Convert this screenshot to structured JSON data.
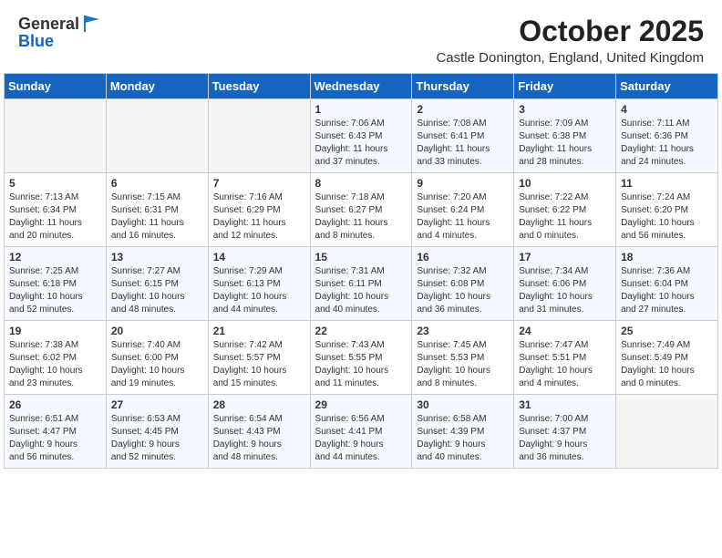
{
  "header": {
    "logo_line1": "General",
    "logo_line2": "Blue",
    "month": "October 2025",
    "location": "Castle Donington, England, United Kingdom"
  },
  "weekdays": [
    "Sunday",
    "Monday",
    "Tuesday",
    "Wednesday",
    "Thursday",
    "Friday",
    "Saturday"
  ],
  "weeks": [
    [
      {
        "day": "",
        "info": ""
      },
      {
        "day": "",
        "info": ""
      },
      {
        "day": "",
        "info": ""
      },
      {
        "day": "1",
        "info": "Sunrise: 7:06 AM\nSunset: 6:43 PM\nDaylight: 11 hours\nand 37 minutes."
      },
      {
        "day": "2",
        "info": "Sunrise: 7:08 AM\nSunset: 6:41 PM\nDaylight: 11 hours\nand 33 minutes."
      },
      {
        "day": "3",
        "info": "Sunrise: 7:09 AM\nSunset: 6:38 PM\nDaylight: 11 hours\nand 28 minutes."
      },
      {
        "day": "4",
        "info": "Sunrise: 7:11 AM\nSunset: 6:36 PM\nDaylight: 11 hours\nand 24 minutes."
      }
    ],
    [
      {
        "day": "5",
        "info": "Sunrise: 7:13 AM\nSunset: 6:34 PM\nDaylight: 11 hours\nand 20 minutes."
      },
      {
        "day": "6",
        "info": "Sunrise: 7:15 AM\nSunset: 6:31 PM\nDaylight: 11 hours\nand 16 minutes."
      },
      {
        "day": "7",
        "info": "Sunrise: 7:16 AM\nSunset: 6:29 PM\nDaylight: 11 hours\nand 12 minutes."
      },
      {
        "day": "8",
        "info": "Sunrise: 7:18 AM\nSunset: 6:27 PM\nDaylight: 11 hours\nand 8 minutes."
      },
      {
        "day": "9",
        "info": "Sunrise: 7:20 AM\nSunset: 6:24 PM\nDaylight: 11 hours\nand 4 minutes."
      },
      {
        "day": "10",
        "info": "Sunrise: 7:22 AM\nSunset: 6:22 PM\nDaylight: 11 hours\nand 0 minutes."
      },
      {
        "day": "11",
        "info": "Sunrise: 7:24 AM\nSunset: 6:20 PM\nDaylight: 10 hours\nand 56 minutes."
      }
    ],
    [
      {
        "day": "12",
        "info": "Sunrise: 7:25 AM\nSunset: 6:18 PM\nDaylight: 10 hours\nand 52 minutes."
      },
      {
        "day": "13",
        "info": "Sunrise: 7:27 AM\nSunset: 6:15 PM\nDaylight: 10 hours\nand 48 minutes."
      },
      {
        "day": "14",
        "info": "Sunrise: 7:29 AM\nSunset: 6:13 PM\nDaylight: 10 hours\nand 44 minutes."
      },
      {
        "day": "15",
        "info": "Sunrise: 7:31 AM\nSunset: 6:11 PM\nDaylight: 10 hours\nand 40 minutes."
      },
      {
        "day": "16",
        "info": "Sunrise: 7:32 AM\nSunset: 6:08 PM\nDaylight: 10 hours\nand 36 minutes."
      },
      {
        "day": "17",
        "info": "Sunrise: 7:34 AM\nSunset: 6:06 PM\nDaylight: 10 hours\nand 31 minutes."
      },
      {
        "day": "18",
        "info": "Sunrise: 7:36 AM\nSunset: 6:04 PM\nDaylight: 10 hours\nand 27 minutes."
      }
    ],
    [
      {
        "day": "19",
        "info": "Sunrise: 7:38 AM\nSunset: 6:02 PM\nDaylight: 10 hours\nand 23 minutes."
      },
      {
        "day": "20",
        "info": "Sunrise: 7:40 AM\nSunset: 6:00 PM\nDaylight: 10 hours\nand 19 minutes."
      },
      {
        "day": "21",
        "info": "Sunrise: 7:42 AM\nSunset: 5:57 PM\nDaylight: 10 hours\nand 15 minutes."
      },
      {
        "day": "22",
        "info": "Sunrise: 7:43 AM\nSunset: 5:55 PM\nDaylight: 10 hours\nand 11 minutes."
      },
      {
        "day": "23",
        "info": "Sunrise: 7:45 AM\nSunset: 5:53 PM\nDaylight: 10 hours\nand 8 minutes."
      },
      {
        "day": "24",
        "info": "Sunrise: 7:47 AM\nSunset: 5:51 PM\nDaylight: 10 hours\nand 4 minutes."
      },
      {
        "day": "25",
        "info": "Sunrise: 7:49 AM\nSunset: 5:49 PM\nDaylight: 10 hours\nand 0 minutes."
      }
    ],
    [
      {
        "day": "26",
        "info": "Sunrise: 6:51 AM\nSunset: 4:47 PM\nDaylight: 9 hours\nand 56 minutes."
      },
      {
        "day": "27",
        "info": "Sunrise: 6:53 AM\nSunset: 4:45 PM\nDaylight: 9 hours\nand 52 minutes."
      },
      {
        "day": "28",
        "info": "Sunrise: 6:54 AM\nSunset: 4:43 PM\nDaylight: 9 hours\nand 48 minutes."
      },
      {
        "day": "29",
        "info": "Sunrise: 6:56 AM\nSunset: 4:41 PM\nDaylight: 9 hours\nand 44 minutes."
      },
      {
        "day": "30",
        "info": "Sunrise: 6:58 AM\nSunset: 4:39 PM\nDaylight: 9 hours\nand 40 minutes."
      },
      {
        "day": "31",
        "info": "Sunrise: 7:00 AM\nSunset: 4:37 PM\nDaylight: 9 hours\nand 36 minutes."
      },
      {
        "day": "",
        "info": ""
      }
    ]
  ]
}
